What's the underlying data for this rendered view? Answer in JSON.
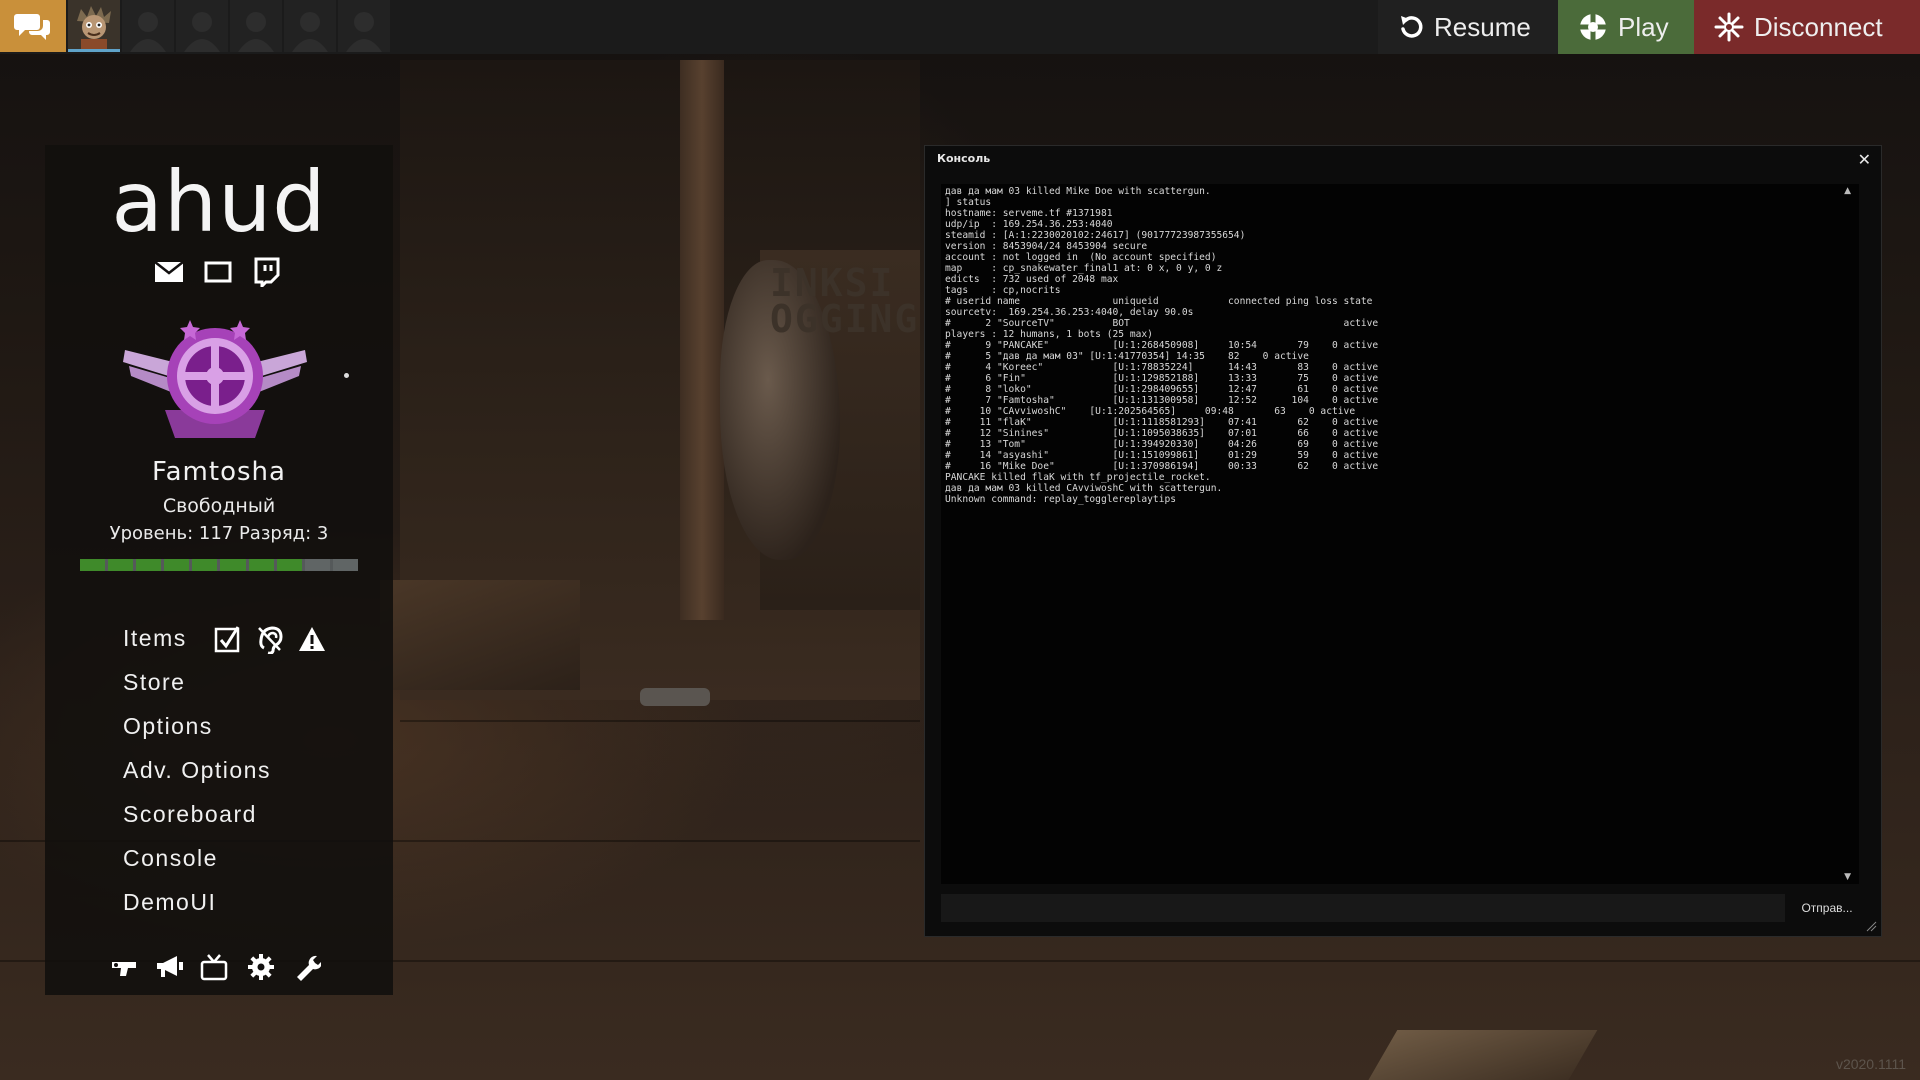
{
  "topbar": {
    "chat_icon": "chat-bubbles-icon",
    "party_slots": 6,
    "resume_label": "Resume",
    "play_label": "Play",
    "disconnect_label": "Disconnect"
  },
  "sidebar": {
    "hud_title": "ahud",
    "social_icons": [
      "mail-icon",
      "square-icon",
      "twitch-icon"
    ],
    "player_name": "Famtosha",
    "player_status": "Свободный",
    "player_level": "Уровень: 117 Разряд: 3",
    "xp_segments_filled": 8,
    "xp_segments_total": 10,
    "menu": {
      "items": "Items",
      "store": "Store",
      "options": "Options",
      "adv_options": "Adv. Options",
      "scoreboard": "Scoreboard",
      "console": "Console",
      "demoui": "DemoUI"
    },
    "items_icons": [
      "checkbox-icon",
      "ear-icon",
      "warning-icon"
    ],
    "bottom_icons": [
      "gun-icon",
      "megaphone-icon",
      "tv-icon",
      "gear-icon",
      "wrench-icon"
    ]
  },
  "console": {
    "title": "Консоль",
    "lines": [
      "дав да мам 03 killed Mike Doe with scattergun.",
      "] status",
      "hostname: serveme.tf #1371981",
      "udp/ip  : 169.254.36.253:4040",
      "steamid : [A:1:2230020102:24617] (90177723987355654)",
      "version : 8453904/24 8453904 secure",
      "account : not logged in  (No account specified)",
      "map     : cp_snakewater_final1 at: 0 x, 0 y, 0 z",
      "edicts  : 732 used of 2048 max",
      "tags    : cp,nocrits",
      "# userid name                uniqueid            connected ping loss state",
      "sourcetv:  169.254.36.253:4040, delay 90.0s",
      "#      2 \"SourceTV\"          BOT                                     active",
      "players : 12 humans, 1 bots (25 max)",
      "#      9 \"PANCAKE\"           [U:1:268450908]     10:54       79    0 active",
      "#      5 \"дав да мам 03\" [U:1:41770354] 14:35    82    0 active",
      "#      4 \"Koreec\"            [U:1:78835224]      14:43       83    0 active",
      "#      6 \"Fin\"               [U:1:129852188]     13:33       75    0 active",
      "#      8 \"loko\"              [U:1:298409655]     12:47       61    0 active",
      "#      7 \"Famtosha\"          [U:1:131300958]     12:52      104    0 active",
      "#     10 \"CAvviwoshC\"    [U:1:202564565]     09:48       63    0 active",
      "#     11 \"flaK\"              [U:1:1118581293]    07:41       62    0 active",
      "#     12 \"Sinines\"           [U:1:1095038635]    07:01       66    0 active",
      "#     13 \"Tom\"               [U:1:394920330]     04:26       69    0 active",
      "#     14 \"asyashi\"           [U:1:151099861]     01:29       59    0 active",
      "#     16 \"Mike Doe\"          [U:1:370986194]     00:33       62    0 active",
      "PANCAKE killed flaK with tf_projectile_rocket.",
      "дав да мам 03 killed CAvviwoshC with scattergun.",
      "Unknown command: replay_togglereplaytips"
    ],
    "input_value": "",
    "submit_label": "Отправ..."
  },
  "scene": {
    "sign_text": "INKSI\nOGGING"
  },
  "version_text": "v2020.1111",
  "colors": {
    "play_bg": "#4b6b3a",
    "disconnect_bg": "#7a2a2a",
    "chat_bg": "#c9903a",
    "xp_fill": "#3f8a2a"
  }
}
